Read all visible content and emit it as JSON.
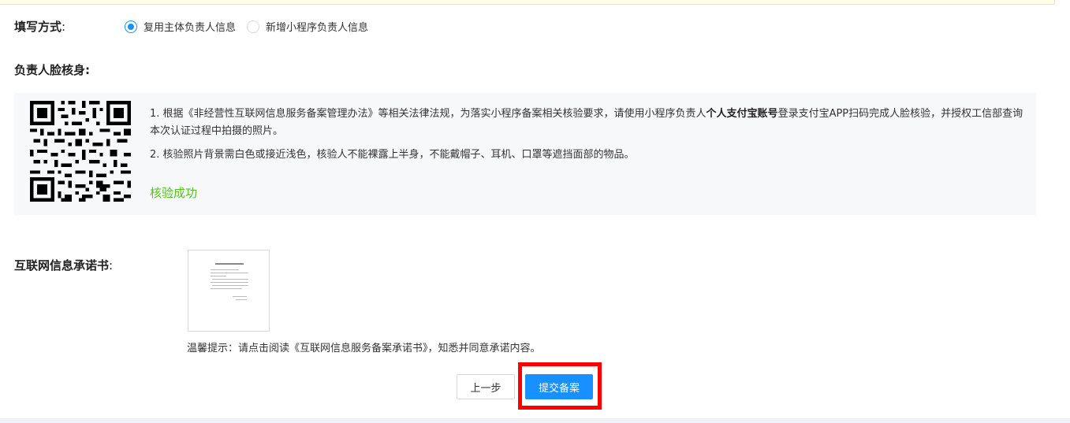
{
  "fill_method": {
    "label": "填写方式",
    "colon": ":",
    "options": [
      {
        "label": "复用主体负责人信息",
        "checked": true
      },
      {
        "label": "新增小程序负责人信息",
        "checked": false
      }
    ]
  },
  "face_verify": {
    "label": "负责人脸核身",
    "colon": ":",
    "para1_pre": "1. 根据《非经营性互联网信息服务备案管理办法》等相关法律法规，为落实小程序备案相关核验要求，请使用小程序负责人",
    "para1_bold": "个人支付宝账号",
    "para1_post": "登录支付宝APP扫码完成人脸核验，并授权工信部查询本次认证过程中拍摄的照片。",
    "para2": "2. 核验照片背景需白色或接近浅色，核验人不能裸露上半身，不能戴帽子、耳机、口罩等遮挡面部的物品。",
    "status": "核验成功",
    "status_color": "#52c41a"
  },
  "pledge": {
    "label": "互联网信息承诺书",
    "colon": ":",
    "tip": "温馨提示：请点击阅读《互联网信息服务备案承诺书》，知悉并同意承诺内容。"
  },
  "buttons": {
    "prev": "上一步",
    "submit": "提交备案"
  },
  "colors": {
    "primary": "#1890ff",
    "highlight": "#ff0000",
    "success": "#52c41a"
  }
}
